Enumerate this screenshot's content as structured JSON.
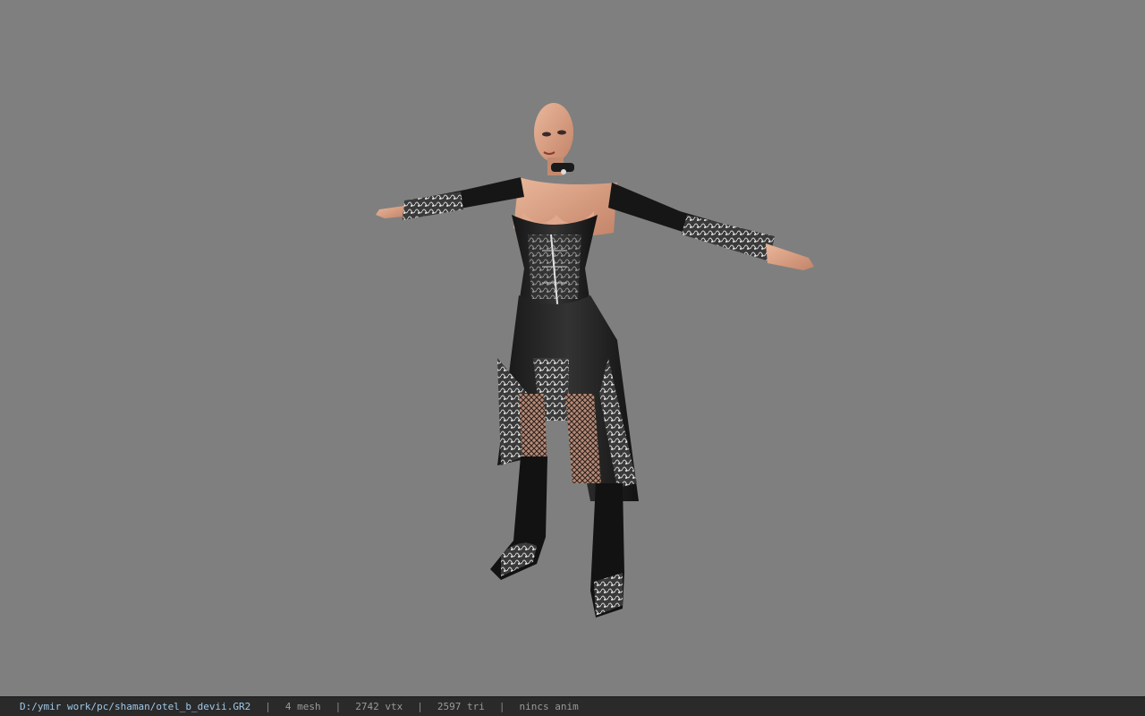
{
  "viewer": {
    "background_color": "#7f7f7f",
    "model_icon": "character-model-icon"
  },
  "statusbar": {
    "file_path": "D:/ymir work/pc/shaman/otel_b_devii.GR2",
    "separator": "|",
    "mesh_count": "4 mesh",
    "vertex_count": "2742 vtx",
    "triangle_count": "2597 tri",
    "anim_status": "nincs anim",
    "colors": {
      "path": "#9fc8e8",
      "text": "#9a9a9a",
      "bar": "#2a2a2a"
    }
  }
}
